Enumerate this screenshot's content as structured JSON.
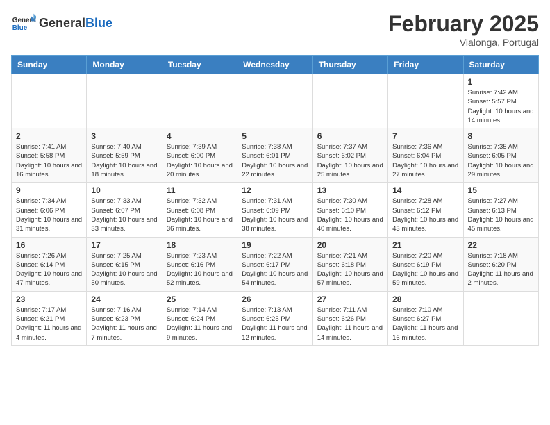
{
  "header": {
    "logo_general": "General",
    "logo_blue": "Blue",
    "month_title": "February 2025",
    "subtitle": "Vialonga, Portugal"
  },
  "days_of_week": [
    "Sunday",
    "Monday",
    "Tuesday",
    "Wednesday",
    "Thursday",
    "Friday",
    "Saturday"
  ],
  "weeks": [
    [
      {
        "day": "",
        "info": ""
      },
      {
        "day": "",
        "info": ""
      },
      {
        "day": "",
        "info": ""
      },
      {
        "day": "",
        "info": ""
      },
      {
        "day": "",
        "info": ""
      },
      {
        "day": "",
        "info": ""
      },
      {
        "day": "1",
        "info": "Sunrise: 7:42 AM\nSunset: 5:57 PM\nDaylight: 10 hours and 14 minutes."
      }
    ],
    [
      {
        "day": "2",
        "info": "Sunrise: 7:41 AM\nSunset: 5:58 PM\nDaylight: 10 hours and 16 minutes."
      },
      {
        "day": "3",
        "info": "Sunrise: 7:40 AM\nSunset: 5:59 PM\nDaylight: 10 hours and 18 minutes."
      },
      {
        "day": "4",
        "info": "Sunrise: 7:39 AM\nSunset: 6:00 PM\nDaylight: 10 hours and 20 minutes."
      },
      {
        "day": "5",
        "info": "Sunrise: 7:38 AM\nSunset: 6:01 PM\nDaylight: 10 hours and 22 minutes."
      },
      {
        "day": "6",
        "info": "Sunrise: 7:37 AM\nSunset: 6:02 PM\nDaylight: 10 hours and 25 minutes."
      },
      {
        "day": "7",
        "info": "Sunrise: 7:36 AM\nSunset: 6:04 PM\nDaylight: 10 hours and 27 minutes."
      },
      {
        "day": "8",
        "info": "Sunrise: 7:35 AM\nSunset: 6:05 PM\nDaylight: 10 hours and 29 minutes."
      }
    ],
    [
      {
        "day": "9",
        "info": "Sunrise: 7:34 AM\nSunset: 6:06 PM\nDaylight: 10 hours and 31 minutes."
      },
      {
        "day": "10",
        "info": "Sunrise: 7:33 AM\nSunset: 6:07 PM\nDaylight: 10 hours and 33 minutes."
      },
      {
        "day": "11",
        "info": "Sunrise: 7:32 AM\nSunset: 6:08 PM\nDaylight: 10 hours and 36 minutes."
      },
      {
        "day": "12",
        "info": "Sunrise: 7:31 AM\nSunset: 6:09 PM\nDaylight: 10 hours and 38 minutes."
      },
      {
        "day": "13",
        "info": "Sunrise: 7:30 AM\nSunset: 6:10 PM\nDaylight: 10 hours and 40 minutes."
      },
      {
        "day": "14",
        "info": "Sunrise: 7:28 AM\nSunset: 6:12 PM\nDaylight: 10 hours and 43 minutes."
      },
      {
        "day": "15",
        "info": "Sunrise: 7:27 AM\nSunset: 6:13 PM\nDaylight: 10 hours and 45 minutes."
      }
    ],
    [
      {
        "day": "16",
        "info": "Sunrise: 7:26 AM\nSunset: 6:14 PM\nDaylight: 10 hours and 47 minutes."
      },
      {
        "day": "17",
        "info": "Sunrise: 7:25 AM\nSunset: 6:15 PM\nDaylight: 10 hours and 50 minutes."
      },
      {
        "day": "18",
        "info": "Sunrise: 7:23 AM\nSunset: 6:16 PM\nDaylight: 10 hours and 52 minutes."
      },
      {
        "day": "19",
        "info": "Sunrise: 7:22 AM\nSunset: 6:17 PM\nDaylight: 10 hours and 54 minutes."
      },
      {
        "day": "20",
        "info": "Sunrise: 7:21 AM\nSunset: 6:18 PM\nDaylight: 10 hours and 57 minutes."
      },
      {
        "day": "21",
        "info": "Sunrise: 7:20 AM\nSunset: 6:19 PM\nDaylight: 10 hours and 59 minutes."
      },
      {
        "day": "22",
        "info": "Sunrise: 7:18 AM\nSunset: 6:20 PM\nDaylight: 11 hours and 2 minutes."
      }
    ],
    [
      {
        "day": "23",
        "info": "Sunrise: 7:17 AM\nSunset: 6:21 PM\nDaylight: 11 hours and 4 minutes."
      },
      {
        "day": "24",
        "info": "Sunrise: 7:16 AM\nSunset: 6:23 PM\nDaylight: 11 hours and 7 minutes."
      },
      {
        "day": "25",
        "info": "Sunrise: 7:14 AM\nSunset: 6:24 PM\nDaylight: 11 hours and 9 minutes."
      },
      {
        "day": "26",
        "info": "Sunrise: 7:13 AM\nSunset: 6:25 PM\nDaylight: 11 hours and 12 minutes."
      },
      {
        "day": "27",
        "info": "Sunrise: 7:11 AM\nSunset: 6:26 PM\nDaylight: 11 hours and 14 minutes."
      },
      {
        "day": "28",
        "info": "Sunrise: 7:10 AM\nSunset: 6:27 PM\nDaylight: 11 hours and 16 minutes."
      },
      {
        "day": "",
        "info": ""
      }
    ]
  ]
}
